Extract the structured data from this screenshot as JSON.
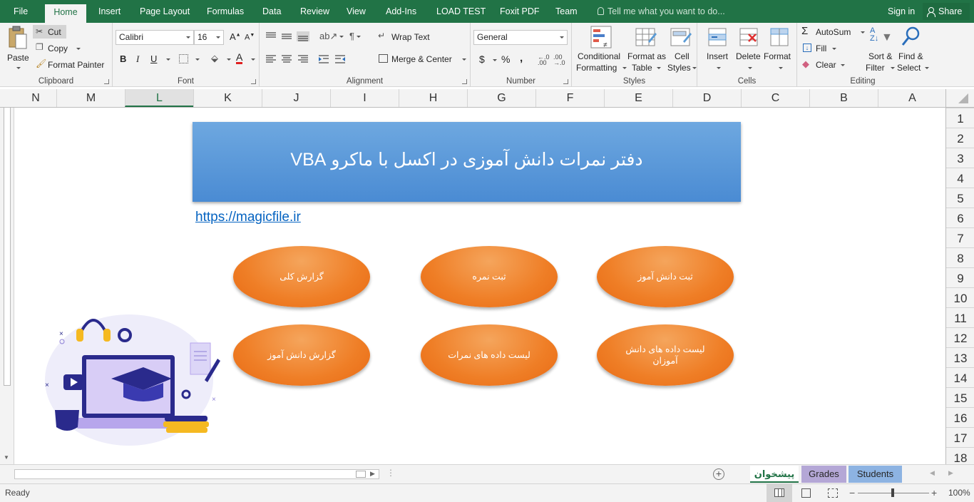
{
  "ribbon_tabs": {
    "file": "File",
    "home": "Home",
    "insert": "Insert",
    "page_layout": "Page Layout",
    "formulas": "Formulas",
    "data": "Data",
    "review": "Review",
    "view": "View",
    "addins": "Add-Ins",
    "load_test": "LOAD TEST",
    "foxit": "Foxit PDF",
    "team": "Team"
  },
  "tell_me": "Tell me what you want to do...",
  "sign_in": "Sign in",
  "share": "Share",
  "clipboard": {
    "paste": "Paste",
    "cut": "Cut",
    "copy": "Copy",
    "format_painter": "Format Painter",
    "label": "Clipboard"
  },
  "font": {
    "name": "Calibri",
    "size": "16",
    "bold": "B",
    "italic": "I",
    "underline": "U",
    "label": "Font"
  },
  "alignment": {
    "wrap_text": "Wrap Text",
    "merge_center": "Merge & Center",
    "label": "Alignment"
  },
  "number": {
    "format": "General",
    "currency": "$",
    "percent": "%",
    "comma": ",",
    "label": "Number"
  },
  "styles": {
    "conditional_1": "Conditional",
    "conditional_2": "Formatting",
    "format_table_1": "Format as",
    "format_table_2": "Table",
    "cell_styles_1": "Cell",
    "cell_styles_2": "Styles",
    "label": "Styles"
  },
  "cells": {
    "insert": "Insert",
    "delete": "Delete",
    "format": "Format",
    "label": "Cells"
  },
  "editing": {
    "autosum": "AutoSum",
    "fill": "Fill",
    "clear": "Clear",
    "sort_1": "Sort &",
    "sort_2": "Filter",
    "find_1": "Find &",
    "find_2": "Select",
    "label": "Editing"
  },
  "columns": [
    "N",
    "M",
    "L",
    "K",
    "J",
    "I",
    "H",
    "G",
    "F",
    "E",
    "D",
    "C",
    "B",
    "A"
  ],
  "selected_column": "L",
  "rows": [
    "1",
    "2",
    "3",
    "4",
    "5",
    "6",
    "7",
    "8",
    "9",
    "10",
    "11",
    "12",
    "13",
    "14",
    "15",
    "16",
    "17",
    "18"
  ],
  "sheet": {
    "title": "دفتر نمرات دانش آموزی در اکسل با ماکرو VBA",
    "link": "https://magicfile.ir",
    "buttons": {
      "general_report": "گزارش کلی",
      "record_grade": "ثبت نمره",
      "record_student": "ثبت دانش آموز",
      "student_report": "گزارش دانش آموز",
      "grades_list": "لیست داده های نمرات",
      "students_list": "لیست داده های دانش آموزان"
    }
  },
  "sheet_tabs": {
    "main": "پیشخوان",
    "grades": "Grades",
    "students": "Students"
  },
  "status": {
    "ready": "Ready",
    "zoom": "100%"
  },
  "colors": {
    "excel_green": "#217346",
    "banner_blue": "#5b9bd5",
    "oval_orange": "#ed7d31",
    "grades_tab": "#b4a7d6",
    "students_tab": "#8db3e2"
  }
}
